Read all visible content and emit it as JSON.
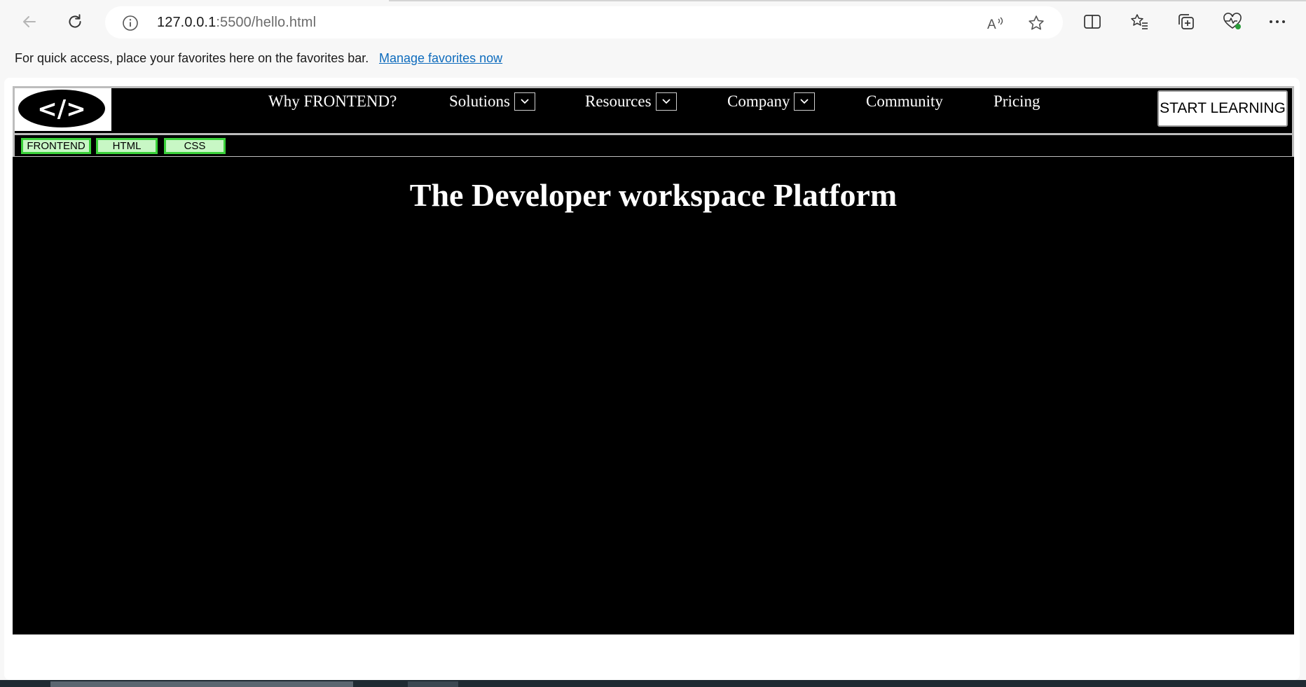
{
  "browser": {
    "url_host": "127.0.0.1",
    "url_rest": ":5500/hello.html",
    "favorites_message": "For quick access, place your favorites here on the favorites bar.",
    "favorites_link": "Manage favorites now",
    "icons": {
      "back": "back-arrow-icon",
      "refresh": "refresh-icon",
      "site_info": "info-icon",
      "read_aloud": "read-aloud-icon",
      "favorite": "star-icon",
      "split_screen": "split-screen-icon",
      "favorites": "favorites-list-icon",
      "collections": "collections-icon",
      "browser_essentials": "heart-pulse-icon",
      "more": "more-ellipsis-icon"
    }
  },
  "site": {
    "logo_text": "</>",
    "nav": [
      {
        "label": "Why FRONTEND?",
        "has_dropdown": false
      },
      {
        "label": "Solutions",
        "has_dropdown": true
      },
      {
        "label": "Resources",
        "has_dropdown": true
      },
      {
        "label": "Company",
        "has_dropdown": true
      },
      {
        "label": "Community",
        "has_dropdown": false
      },
      {
        "label": "Pricing",
        "has_dropdown": false
      }
    ],
    "cta": "START LEARNING",
    "tags": [
      "FRONTEND",
      "HTML",
      "CSS"
    ],
    "hero_title": "The Developer workspace Platform"
  },
  "colors": {
    "page_bg": "#000000",
    "chip_bg": "#c8f7c5",
    "chip_border": "#3ad13a",
    "link": "#0f6cbd"
  }
}
